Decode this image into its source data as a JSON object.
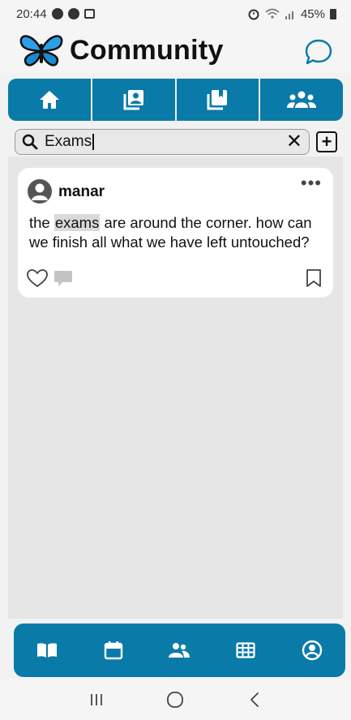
{
  "status_bar": {
    "time": "20:44",
    "battery": "45%"
  },
  "header": {
    "title": "Community",
    "logo_icon": "butterfly-icon",
    "chat_icon": "chat-bubble-icon"
  },
  "top_tabs": [
    {
      "id": "home",
      "icon": "home-icon"
    },
    {
      "id": "contacts",
      "icon": "contact-book-icon"
    },
    {
      "id": "library",
      "icon": "bookmark-library-icon"
    },
    {
      "id": "groups",
      "icon": "groups-icon"
    }
  ],
  "search": {
    "value": "Exams",
    "clear_icon": "close-icon",
    "add_icon": "add-square-icon"
  },
  "post": {
    "author": "manar",
    "text_before": "the ",
    "text_highlight": "exams",
    "text_after": " are around the corner. how can we finish all what we have left untouched?"
  },
  "bottom_nav": [
    {
      "id": "book",
      "icon": "book-icon"
    },
    {
      "id": "calendar",
      "icon": "calendar-icon"
    },
    {
      "id": "community",
      "icon": "people-icon"
    },
    {
      "id": "table",
      "icon": "grid-table-icon"
    },
    {
      "id": "profile",
      "icon": "profile-icon"
    }
  ],
  "colors": {
    "primary": "#0a7aa8",
    "logo": "#1f7fc4"
  }
}
